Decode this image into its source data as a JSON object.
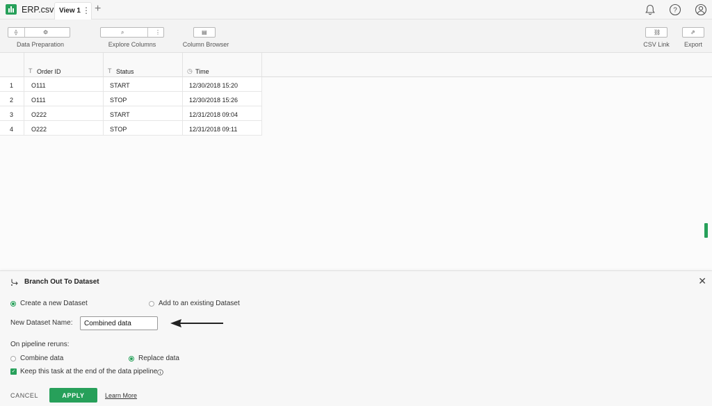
{
  "app": {
    "filename": "ERP.csv"
  },
  "tabs": [
    {
      "label": "View 1"
    }
  ],
  "toolbar": {
    "data_preparation": "Data Preparation",
    "explore_columns": "Explore Columns",
    "column_browser": "Column Browser",
    "csv_link": "CSV Link",
    "export": "Export"
  },
  "table": {
    "columns": [
      {
        "label": "Order ID",
        "type_icon": "text-type-icon"
      },
      {
        "label": "Status",
        "type_icon": "text-type-icon"
      },
      {
        "label": "Time",
        "type_icon": "clock-icon"
      }
    ],
    "rows": [
      {
        "num": "1",
        "order_id": "O111",
        "status": "START",
        "time": "12/30/2018 15:20"
      },
      {
        "num": "2",
        "order_id": "O111",
        "status": "STOP",
        "time": "12/30/2018 15:26"
      },
      {
        "num": "3",
        "order_id": "O222",
        "status": "START",
        "time": "12/31/2018 09:04"
      },
      {
        "num": "4",
        "order_id": "O222",
        "status": "STOP",
        "time": "12/31/2018 09:11"
      }
    ]
  },
  "panel": {
    "title": "Branch Out To Dataset",
    "create_new": "Create a new Dataset",
    "add_existing": "Add to an existing Dataset",
    "name_label": "New Dataset Name:",
    "name_value": "Combined data",
    "reruns_label": "On pipeline reruns:",
    "combine": "Combine data",
    "replace": "Replace data",
    "keep_task": "Keep this task at the end of the data pipeline",
    "cancel": "CANCEL",
    "apply": "APPLY",
    "learn_more": "Learn More"
  },
  "colors": {
    "accent": "#27a05a"
  }
}
